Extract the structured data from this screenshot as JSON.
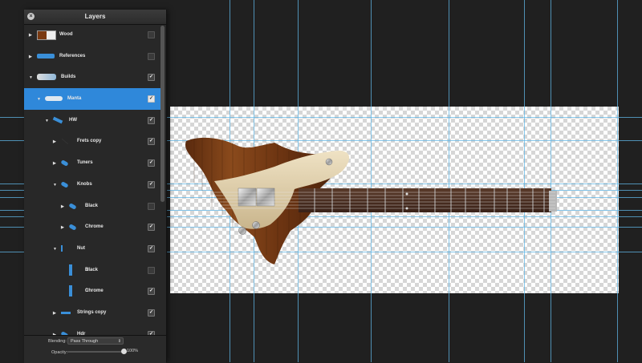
{
  "panel": {
    "title": "Layers",
    "close_glyph": "×"
  },
  "layers": [
    {
      "label": "Wood",
      "expanded": false,
      "visible": false,
      "thumb": "wood-swatch",
      "fx": false
    },
    {
      "label": "References",
      "expanded": false,
      "visible": false,
      "thumb": "guitar-silhouette",
      "fx": false
    },
    {
      "label": "Builds",
      "expanded": true,
      "visible": true,
      "thumb": "build-thumb",
      "fx": false
    },
    {
      "label": "Manta",
      "expanded": true,
      "visible": true,
      "thumb": "manta-thumb",
      "fx": false,
      "selected": true
    },
    {
      "label": "HW",
      "expanded": true,
      "visible": true,
      "thumb": "hw-thumb",
      "fx": false
    },
    {
      "label": "Frets copy",
      "expanded": false,
      "visible": true,
      "thumb": "line-thumb",
      "fx": false
    },
    {
      "label": "Tuners",
      "expanded": false,
      "visible": true,
      "thumb": "blue-pill",
      "fx": false
    },
    {
      "label": "Knobs",
      "expanded": true,
      "visible": true,
      "thumb": "blue-pill",
      "fx": false
    },
    {
      "label": "Black",
      "expanded": false,
      "visible": false,
      "thumb": "blue-pill",
      "fx": false
    },
    {
      "label": "Chrome",
      "expanded": false,
      "visible": true,
      "thumb": "blue-pill",
      "fx": false
    },
    {
      "label": "Nut",
      "expanded": true,
      "visible": true,
      "thumb": "thin-bar",
      "fx": false
    },
    {
      "label": "Black",
      "expanded": false,
      "visible": false,
      "thumb": "tall-bar",
      "fx": true
    },
    {
      "label": "Chrome",
      "expanded": false,
      "visible": true,
      "thumb": "tall-bar",
      "fx": true
    },
    {
      "label": "Strings copy",
      "expanded": false,
      "visible": true,
      "thumb": "flat-bar",
      "fx": false
    },
    {
      "label": "Hdr",
      "expanded": false,
      "visible": true,
      "thumb": "blue-pill",
      "fx": false
    }
  ],
  "footer": {
    "blending_label": "Blending:",
    "blending_value": "Pass Through",
    "opacity_label": "Opacity:",
    "opacity_value": "100%",
    "opacity_fraction": 1.0
  },
  "colors": {
    "selection": "#2f88da",
    "guide": "#5fb6e6",
    "thumb_blue": "#3a8fd8"
  }
}
